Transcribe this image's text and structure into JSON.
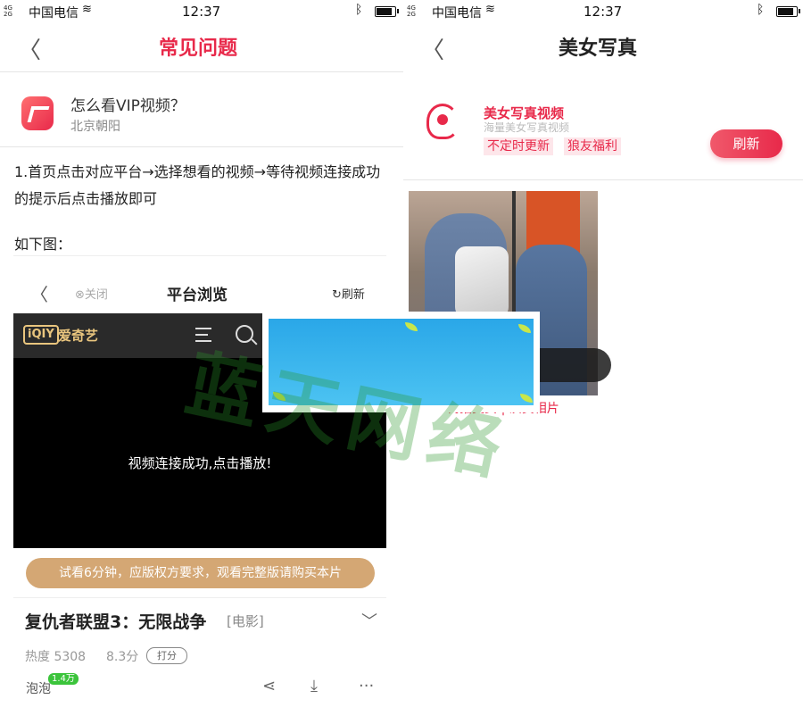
{
  "left": {
    "status": {
      "carrier": "中国电信",
      "time": "12:37"
    },
    "nav": {
      "title": "常见问题"
    },
    "question": {
      "title": "怎么看VIP视频？",
      "location": "北京朝阳"
    },
    "answer": {
      "step1": "1.首页点击对应平台→选择想看的视频→等待视频连接成功的提示后点击播放即可",
      "see_below": "如下图："
    },
    "inner_screen": {
      "title": "平台浏览",
      "close_label": "⊗关闭",
      "refresh_label": "↻刷新",
      "player_brand_logo": "iQIY",
      "player_brand_name": "爱奇艺",
      "player_message": "视频连接成功,点击播放!",
      "trial_notice": "试看6分钟，应版权方要求，观看完整版请购买本片",
      "movie_title": "复仇者联盟3：无限战争",
      "movie_tag": "[电影]",
      "heat": "热度 5308",
      "score": "8.3分",
      "rate_label": "打分",
      "paopao_label": "泡泡",
      "paopao_count": "1.4万"
    }
  },
  "right": {
    "status": {
      "carrier": "中国电信",
      "time": "12:37"
    },
    "nav": {
      "title": "美女写真"
    },
    "channel": {
      "name": "美女写真视频",
      "subtitle": "海量美女写真视频",
      "tags": [
        "不定时更新",
        "狼友福利"
      ],
      "refresh_label": "刷新"
    },
    "card": {
      "caption": "街拍美女 | 演员相片"
    }
  },
  "watermark": "蓝天网络",
  "colors": {
    "accent": "#e8294a",
    "gold": "#d4a774",
    "iqiyi_gold": "#e9c57e"
  }
}
